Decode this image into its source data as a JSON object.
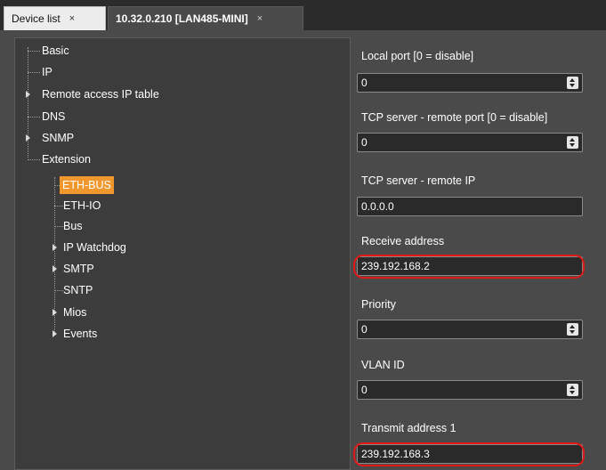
{
  "tabs": [
    {
      "label": "Device list",
      "close": "×"
    },
    {
      "label": "10.32.0.210 [LAN485-MINI]",
      "close": "×"
    }
  ],
  "tree": {
    "items": {
      "basic": "Basic",
      "ip": "IP",
      "remote_access": "Remote access IP table",
      "dns": "DNS",
      "snmp": "SNMP",
      "extension": "Extension",
      "eth_bus": "ETH-BUS",
      "eth_io": "ETH-IO",
      "bus": "Bus",
      "ip_watchdog": "IP Watchdog",
      "smtp": "SMTP",
      "sntp": "SNTP",
      "mios": "Mios",
      "events": "Events"
    },
    "selected": "ETH-BUS",
    "accent_color": "#f0982e"
  },
  "properties": {
    "local_port": {
      "label": "Local port [0 = disable]",
      "value": "0"
    },
    "tcp_remote_port": {
      "label": "TCP server - remote port [0 = disable]",
      "value": "0"
    },
    "tcp_remote_ip": {
      "label": "TCP server - remote IP",
      "value": "0.0.0.0"
    },
    "receive_address": {
      "label": "Receive address",
      "value": "239.192.168.2"
    },
    "priority": {
      "label": "Priority",
      "value": "0"
    },
    "vlan_id": {
      "label": "VLAN ID",
      "value": "0"
    },
    "transmit_address_1": {
      "label": "Transmit address 1",
      "value": "239.192.168.3"
    }
  },
  "highlight_color": "#e01818"
}
